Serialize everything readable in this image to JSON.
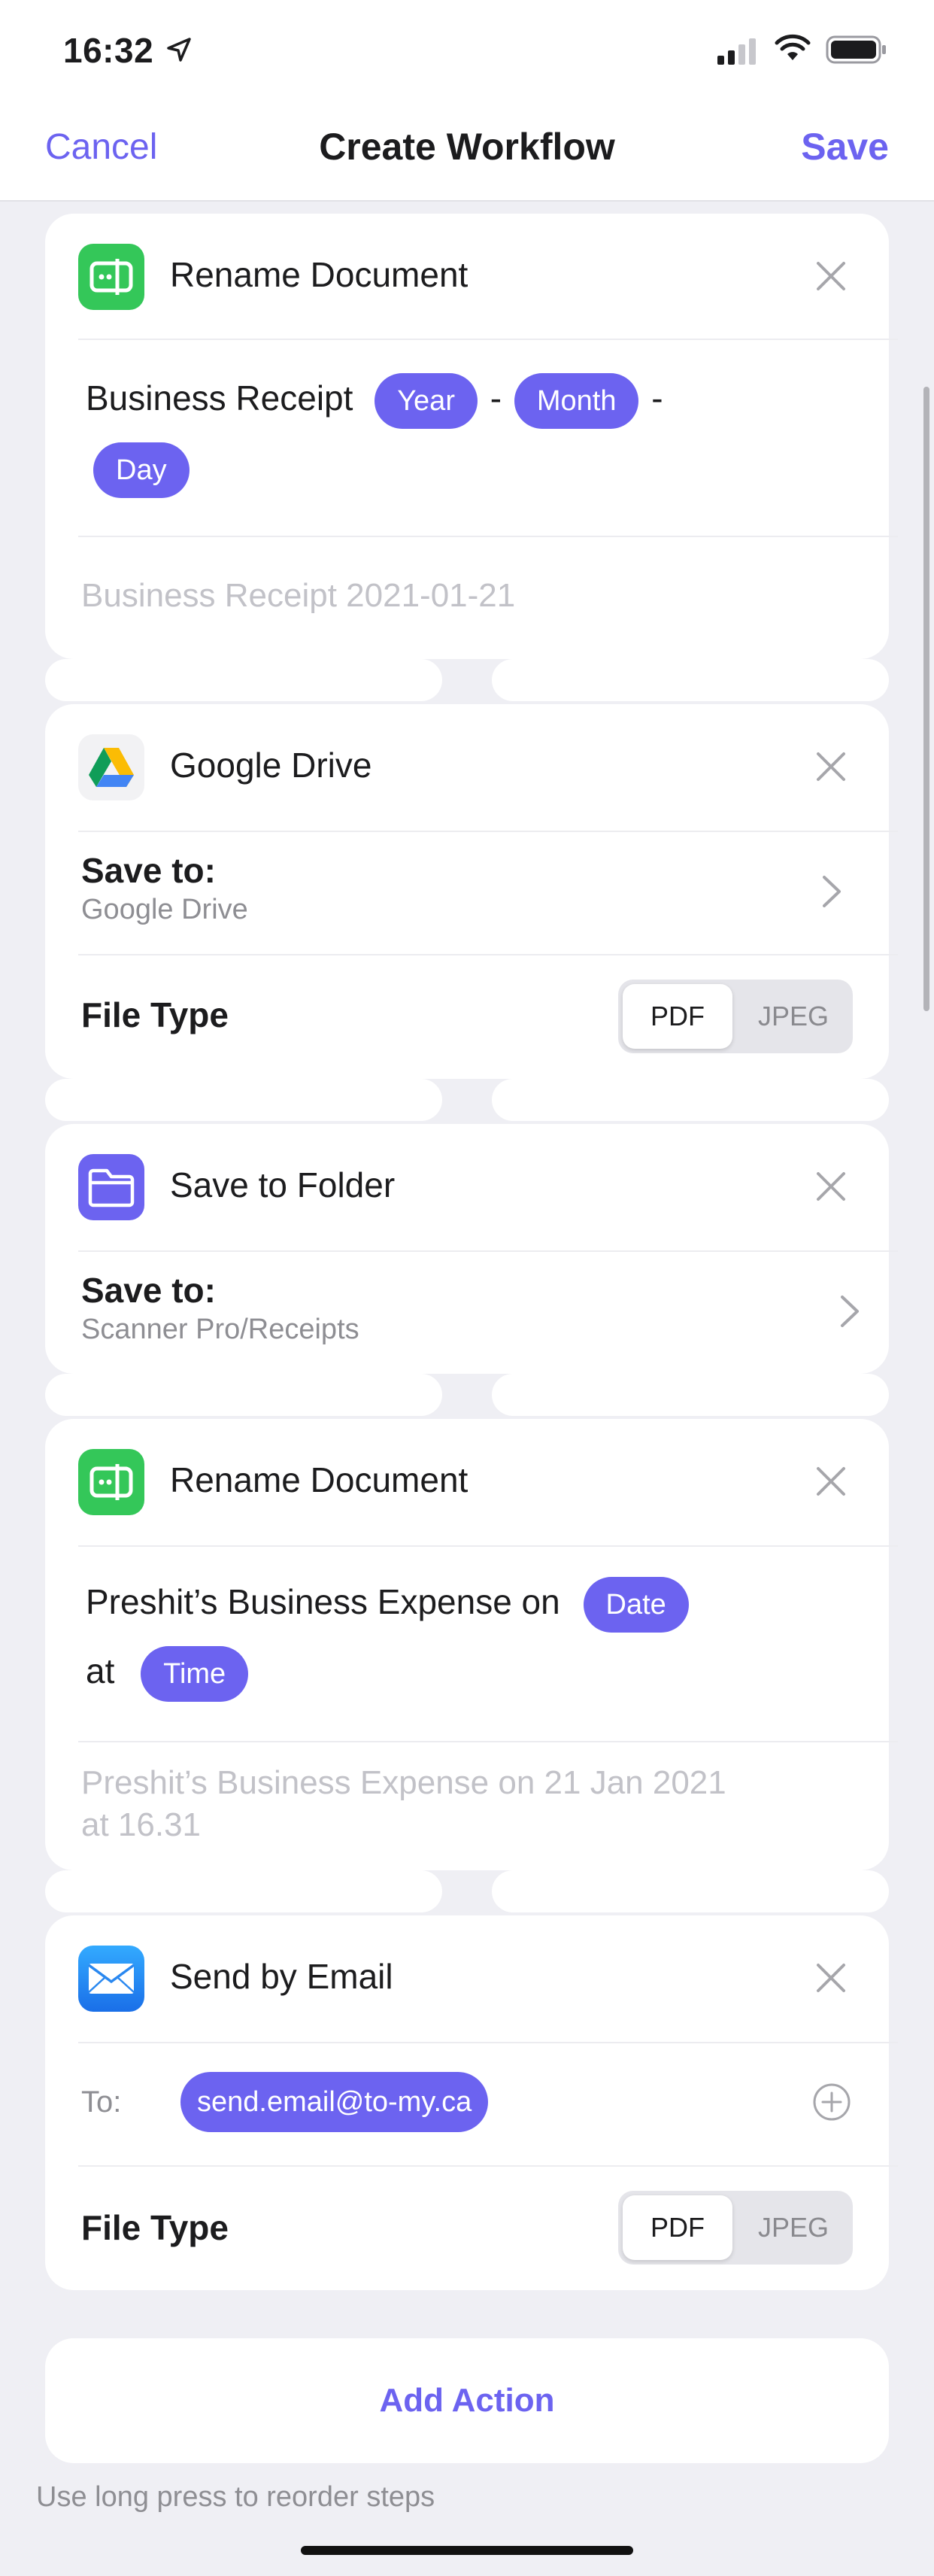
{
  "status_bar": {
    "time": "16:32"
  },
  "nav": {
    "cancel": "Cancel",
    "title": "Create Workflow",
    "save": "Save"
  },
  "colors": {
    "accent": "#6c63f0",
    "green": "#34c759",
    "background": "#efeff4"
  },
  "cards": {
    "rename1": {
      "title": "Rename Document",
      "text_prefix": "Business Receipt",
      "tokens": [
        "Year",
        "Month",
        "Day"
      ],
      "separator": "-",
      "preview": "Business Receipt 2021-01-21"
    },
    "gdrive": {
      "title": "Google Drive",
      "save_to_label": "Save to:",
      "save_to_value": "Google Drive",
      "file_type_label": "File Type",
      "file_type_options": [
        "PDF",
        "JPEG"
      ],
      "file_type_selected": "PDF"
    },
    "folder": {
      "title": "Save to Folder",
      "save_to_label": "Save to:",
      "save_to_value": "Scanner Pro/Receipts"
    },
    "rename2": {
      "title": "Rename Document",
      "text_prefix": "Preshit’s Business Expense on",
      "token_date": "Date",
      "text_at": "at",
      "token_time": "Time",
      "preview_line1": "Preshit’s Business Expense on 21 Jan 2021",
      "preview_line2": "at 16.31"
    },
    "email": {
      "title": "Send by Email",
      "to_label": "To:",
      "recipient": "send.email@to-my.ca",
      "file_type_label": "File Type",
      "file_type_options": [
        "PDF",
        "JPEG"
      ],
      "file_type_selected": "PDF"
    }
  },
  "add_action": "Add Action",
  "hint": "Use long press to reorder steps",
  "icons": [
    "location-arrow-icon",
    "cellular-signal-icon",
    "wifi-icon",
    "battery-icon",
    "rename-icon",
    "google-drive-icon",
    "folder-icon",
    "mail-icon",
    "close-icon",
    "chevron-right-icon",
    "plus-circle-icon"
  ]
}
